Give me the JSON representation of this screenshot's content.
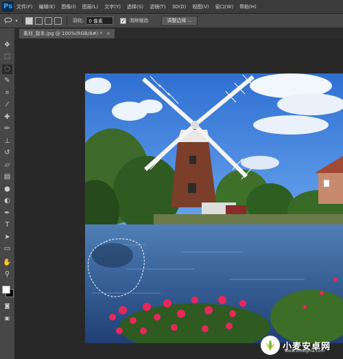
{
  "app": {
    "logo": "Ps"
  },
  "menu": {
    "items": [
      "文件(F)",
      "编辑(E)",
      "图像(I)",
      "图层(L)",
      "文字(Y)",
      "选择(S)",
      "滤镜(T)",
      "3D(D)",
      "视图(V)",
      "窗口(W)",
      "帮助(H)"
    ]
  },
  "options": {
    "tool_icon": "lasso-icon",
    "feather_label": "羽化:",
    "feather_value": "0 像素",
    "antialias_label": "消除锯齿",
    "antialias_checked": true,
    "refine_edge_label": "调整边缘 ..."
  },
  "document": {
    "tab_title": "素材_副本.jpg @ 100%(RGB/8#) *",
    "tab_close": "×"
  },
  "toolbar": {
    "tools": [
      "move-tool-icon",
      "marquee-tool-icon",
      "lasso-tool-icon",
      "quick-select-tool-icon",
      "crop-tool-icon",
      "eyedropper-tool-icon",
      "healing-brush-icon",
      "brush-tool-icon",
      "clone-stamp-icon",
      "history-brush-icon",
      "eraser-tool-icon",
      "gradient-tool-icon",
      "blur-tool-icon",
      "dodge-tool-icon",
      "pen-tool-icon",
      "type-tool-icon",
      "path-select-icon",
      "shape-tool-icon",
      "hand-tool-icon",
      "zoom-tool-icon"
    ],
    "active_tool": "lasso-tool-icon",
    "foreground_color": "#ffffff",
    "background_color": "#000000"
  },
  "watermark": {
    "text": "小麦安卓网",
    "url": "www.xmsigma.com"
  },
  "colors": {
    "menubar_bg": "#3b3b3b",
    "panel_bg": "#474747",
    "canvas_bg": "#282828",
    "accent_blue": "#31a8ff"
  }
}
